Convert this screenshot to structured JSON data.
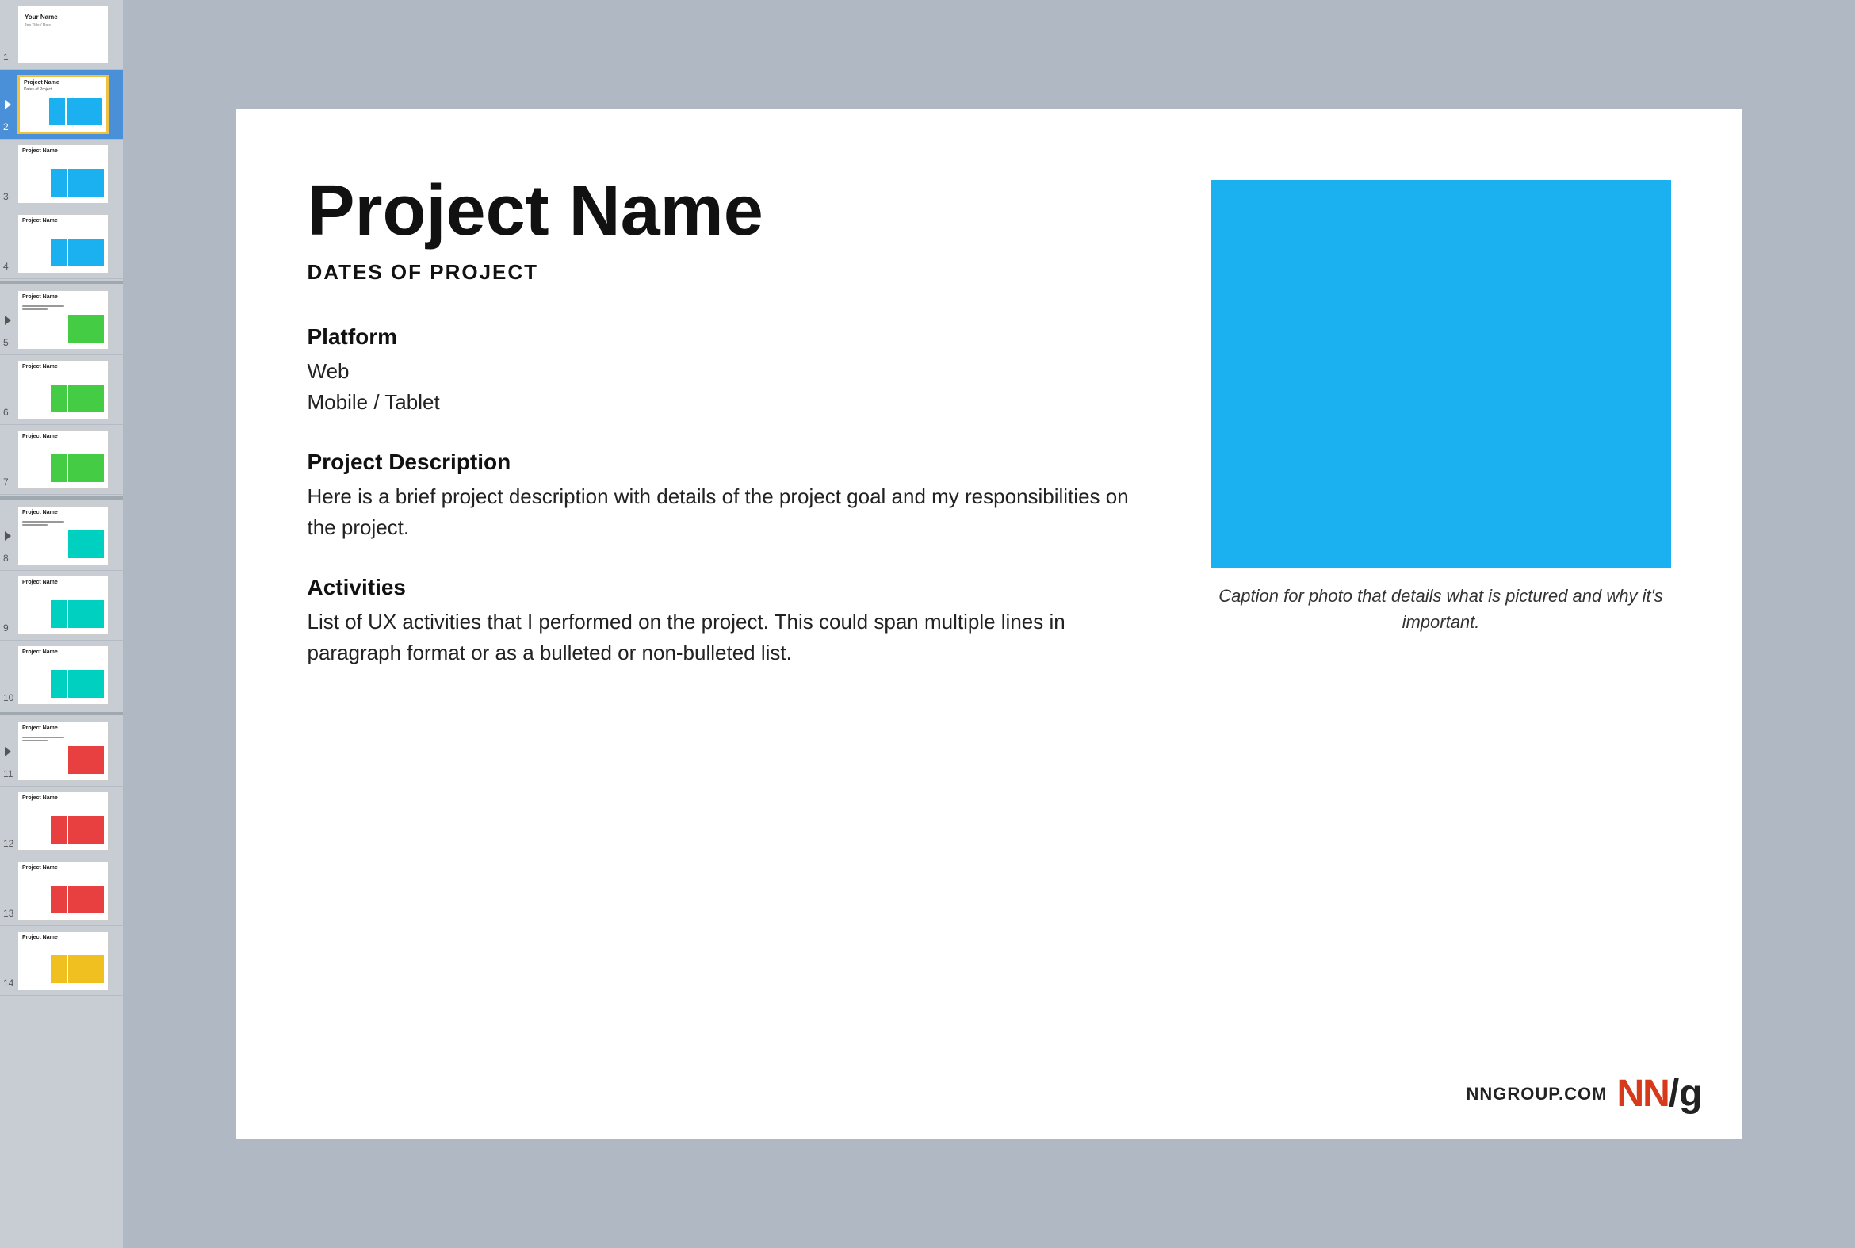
{
  "sidebar": {
    "slides": [
      {
        "number": "1",
        "type": "cover",
        "active": false,
        "name": "Your Name",
        "subtitle": "Job Title / Role"
      },
      {
        "number": "2",
        "type": "project",
        "active": true,
        "hasTriangle": true,
        "color": "#1bb0f0"
      },
      {
        "number": "3",
        "type": "project",
        "active": false,
        "color": "#1bb0f0"
      },
      {
        "number": "4",
        "type": "project",
        "active": false,
        "color": "#1bb0f0"
      },
      {
        "number": "5",
        "type": "project",
        "active": false,
        "hasTriangle": true,
        "color": "#44cc44"
      },
      {
        "number": "6",
        "type": "project",
        "active": false,
        "color": "#44cc44"
      },
      {
        "number": "7",
        "type": "project",
        "active": false,
        "color": "#44cc44"
      },
      {
        "number": "8",
        "type": "project",
        "active": false,
        "hasTriangle": true,
        "color": "#00d0c0"
      },
      {
        "number": "9",
        "type": "project",
        "active": false,
        "color": "#00d0c0"
      },
      {
        "number": "10",
        "type": "project",
        "active": false,
        "color": "#00d0c0"
      },
      {
        "number": "11",
        "type": "project",
        "active": false,
        "hasTriangle": true,
        "color": "#e84040"
      },
      {
        "number": "12",
        "type": "project",
        "active": false,
        "color": "#e84040"
      },
      {
        "number": "13",
        "type": "project",
        "active": false,
        "color": "#e84040"
      },
      {
        "number": "14",
        "type": "project",
        "active": false,
        "color": "#f0c020"
      }
    ]
  },
  "slide": {
    "projectName": "Project Name",
    "datesLabel": "DATES OF PROJECT",
    "platform": {
      "heading": "Platform",
      "lines": [
        "Web",
        "Mobile / Tablet"
      ]
    },
    "projectDescription": {
      "heading": "Project Description",
      "text": "Here is a brief project description with details of the project goal and my responsibilities on the project."
    },
    "activities": {
      "heading": "Activities",
      "text": "List of UX activities that I performed on the project. This could span multiple lines in paragraph format or as a bulleted or non-bulleted list."
    },
    "photoColor": "#1bb0f0",
    "photoCaption": "Caption for photo that details what is pictured and why it's important."
  },
  "footer": {
    "url": "NNGROUP.COM",
    "logoNN": "NN",
    "logoSlash": "/",
    "logoG": "g"
  }
}
